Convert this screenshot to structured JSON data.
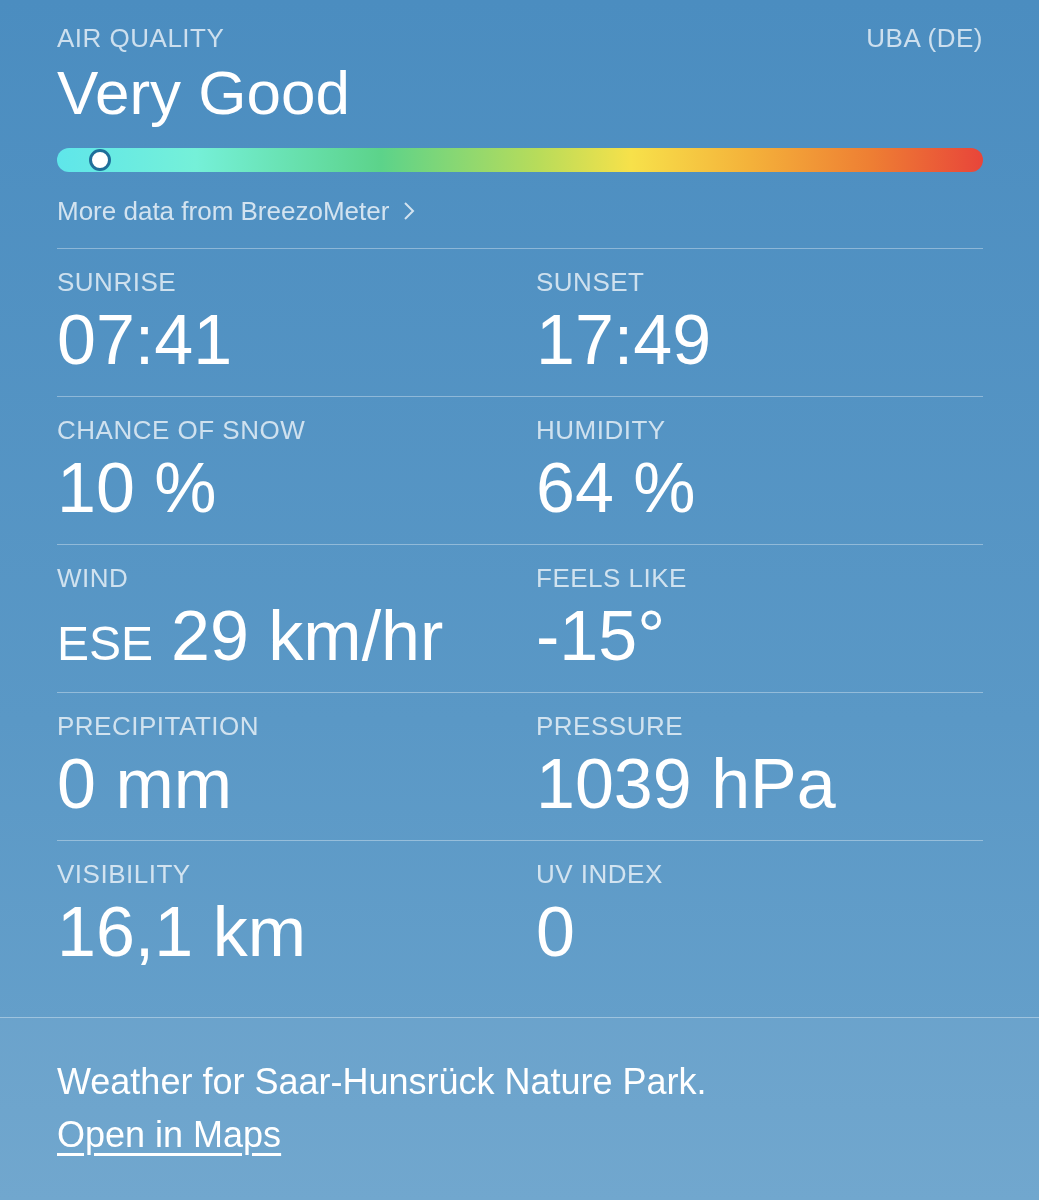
{
  "air_quality": {
    "label": "AIR QUALITY",
    "source": "UBA (DE)",
    "value": "Very Good",
    "level": 0.03,
    "more_link": "More data from BreezoMeter"
  },
  "details": [
    {
      "label": "SUNRISE",
      "value": "07:41"
    },
    {
      "label": "SUNSET",
      "value": "17:49"
    },
    {
      "label": "CHANCE OF SNOW",
      "value": "10 %"
    },
    {
      "label": "HUMIDITY",
      "value": "64 %"
    },
    {
      "label": "WIND",
      "direction": "ESE",
      "value": "29 km/hr"
    },
    {
      "label": "FEELS LIKE",
      "value": "-15°"
    },
    {
      "label": "PRECIPITATION",
      "value": "0 mm"
    },
    {
      "label": "PRESSURE",
      "value": "1039 hPa"
    },
    {
      "label": "VISIBILITY",
      "value": "16,1 km"
    },
    {
      "label": "UV INDEX",
      "value": "0"
    }
  ],
  "footer": {
    "text": "Weather for Saar-Hunsrück Nature Park.",
    "link": "Open in Maps"
  }
}
